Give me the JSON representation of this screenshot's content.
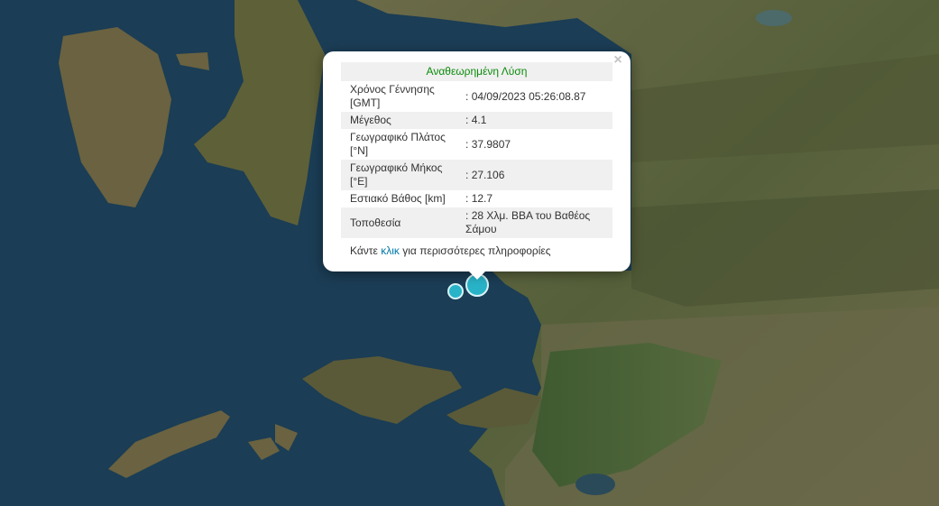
{
  "popup": {
    "title": "Αναθεωρημένη Λύση",
    "close_label": "×",
    "rows": [
      {
        "label": "Χρόνος Γέννησης [GMT]",
        "value": ": 04/09/2023 05:26:08.87"
      },
      {
        "label": "Μέγεθος",
        "value": ": 4.1"
      },
      {
        "label": "Γεωγραφικό Πλάτος [°N]",
        "value": ": 37.9807"
      },
      {
        "label": "Γεωγραφικό Μήκος [°E]",
        "value": ": 27.106"
      },
      {
        "label": "Εστιακό Βάθος [km]",
        "value": ": 12.7"
      },
      {
        "label": "Τοποθεσία",
        "value": ": 28 Χλμ. ΒΒΑ του Βαθέος Σάμου"
      }
    ],
    "more_prefix": "Κάντε",
    "more_link": "κλικ",
    "more_suffix": "για περισσότερες πληροφορίες"
  },
  "map": {
    "sea_color": "#1a3b52",
    "land_color": "#5a5a3a",
    "marker_color": "#29b3c8",
    "markers": [
      {
        "name": "earthquake-marker-main",
        "magnitude": 4.1
      },
      {
        "name": "earthquake-marker-small",
        "magnitude": null
      }
    ]
  }
}
